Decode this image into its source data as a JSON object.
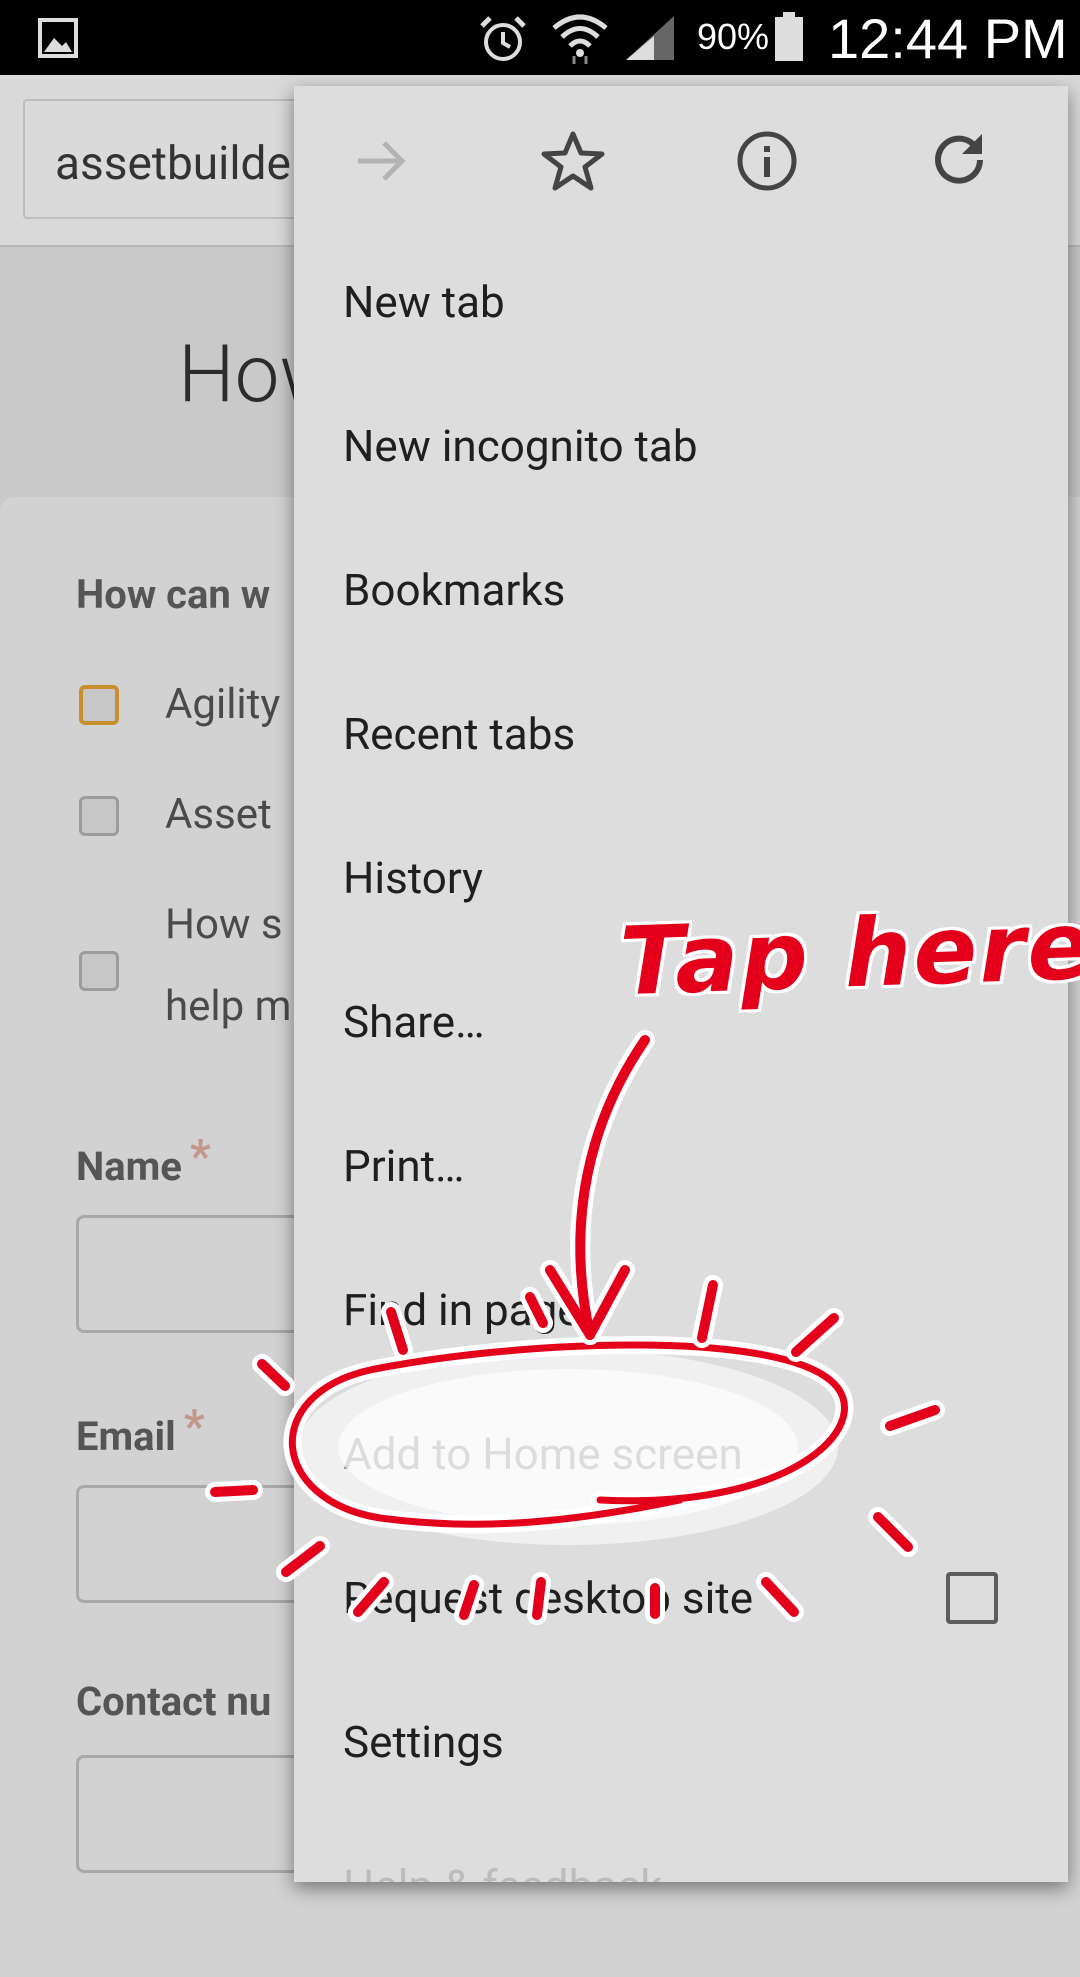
{
  "status_bar": {
    "battery_percent": "90%",
    "time": "12:44 PM",
    "icons": [
      "gallery-icon",
      "alarm-icon",
      "wifi-icon",
      "signal-icon",
      "battery-icon"
    ]
  },
  "browser": {
    "url_text": "assetbuilde"
  },
  "page": {
    "heading": "How",
    "question": "How can w",
    "options": [
      {
        "label": "Agility"
      },
      {
        "label": "Asset"
      },
      {
        "label_line1": "How s",
        "label_line2": "help m"
      }
    ],
    "fields": [
      {
        "label": "Name",
        "required_mark": "*"
      },
      {
        "label": "Email",
        "required_mark": "*"
      },
      {
        "label": "Contact nu"
      }
    ]
  },
  "menu": {
    "icon_row": [
      "forward-icon",
      "bookmark-star-icon",
      "info-icon",
      "reload-icon"
    ],
    "items": [
      {
        "label": "New tab"
      },
      {
        "label": "New incognito tab"
      },
      {
        "label": "Bookmarks"
      },
      {
        "label": "Recent tabs"
      },
      {
        "label": "History"
      },
      {
        "label": "Share…"
      },
      {
        "label": "Print…"
      },
      {
        "label": "Find in page"
      },
      {
        "label": "Add to Home screen"
      },
      {
        "label": "Request desktop site"
      },
      {
        "label": "Settings"
      },
      {
        "label": "Help & feedback"
      }
    ]
  },
  "annotation": {
    "text": "Tap here",
    "color": "#e4001b"
  }
}
